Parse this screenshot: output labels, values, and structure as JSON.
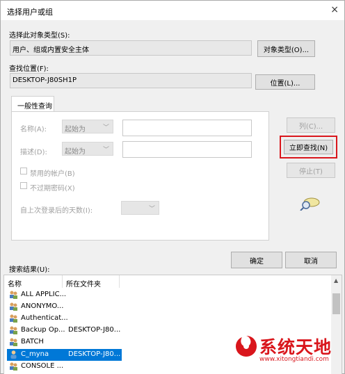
{
  "window": {
    "title": "选择用户或组",
    "close_glyph": "×"
  },
  "object_type": {
    "label": "选择此对象类型(S):",
    "value": "用户、组或内置安全主体",
    "button": "对象类型(O)..."
  },
  "location": {
    "label": "查找位置(F):",
    "value": "DESKTOP-J80SH1P",
    "button": "位置(L)..."
  },
  "query": {
    "tab": "一般性查询",
    "name_label": "名称(A):",
    "name_mode": "起始为",
    "desc_label": "描述(D):",
    "desc_mode": "起始为",
    "disabled_accounts": "禁用的帐户(B)",
    "non_expiring_pwd": "不过期密码(X)",
    "days_since_login": "自上次登录后的天数(I):"
  },
  "actions": {
    "columns": "列(C)...",
    "find_now": "立即查找(N)",
    "stop": "停止(T)"
  },
  "dialog": {
    "ok": "确定",
    "cancel": "取消"
  },
  "results": {
    "label": "搜索结果(U):",
    "columns": [
      "名称",
      "所在文件夹"
    ],
    "rows": [
      {
        "name": "ALL APPLIC...",
        "folder": ""
      },
      {
        "name": "ANONYMO...",
        "folder": ""
      },
      {
        "name": "Authenticat...",
        "folder": ""
      },
      {
        "name": "Backup Op...",
        "folder": "DESKTOP-J80..."
      },
      {
        "name": "BATCH",
        "folder": ""
      },
      {
        "name": "C_myna",
        "folder": "DESKTOP-J80..."
      },
      {
        "name": "CONSOLE ...",
        "folder": ""
      }
    ],
    "selected_row": "C_myna"
  },
  "watermark": {
    "text": "系统天地",
    "url": "www.xitongtiandi.com"
  },
  "colors": {
    "highlight": "#d9161c",
    "selection": "#0078d7"
  }
}
